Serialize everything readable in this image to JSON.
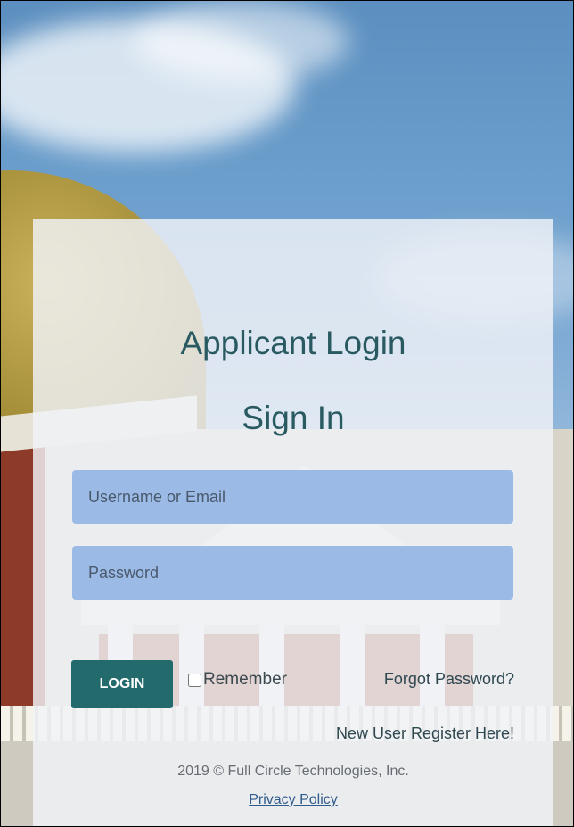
{
  "login": {
    "heading": "Applicant Login",
    "subheading": "Sign In",
    "username_placeholder": "Username or Email",
    "password_placeholder": "Password",
    "login_button_label": "LOGIN",
    "remember_label": "Remember",
    "remember_checked": false,
    "forgot_password_link": "Forgot Password?",
    "register_link": "New User Register Here!"
  },
  "footer": {
    "copyright": "2019 © Full Circle Technologies, Inc.",
    "privacy_link": "Privacy Policy"
  },
  "colors": {
    "heading_text": "#2a5a61",
    "login_button": "#236a6d",
    "input_background": "#9bbae6",
    "panel_background": "#f0f3f8"
  }
}
